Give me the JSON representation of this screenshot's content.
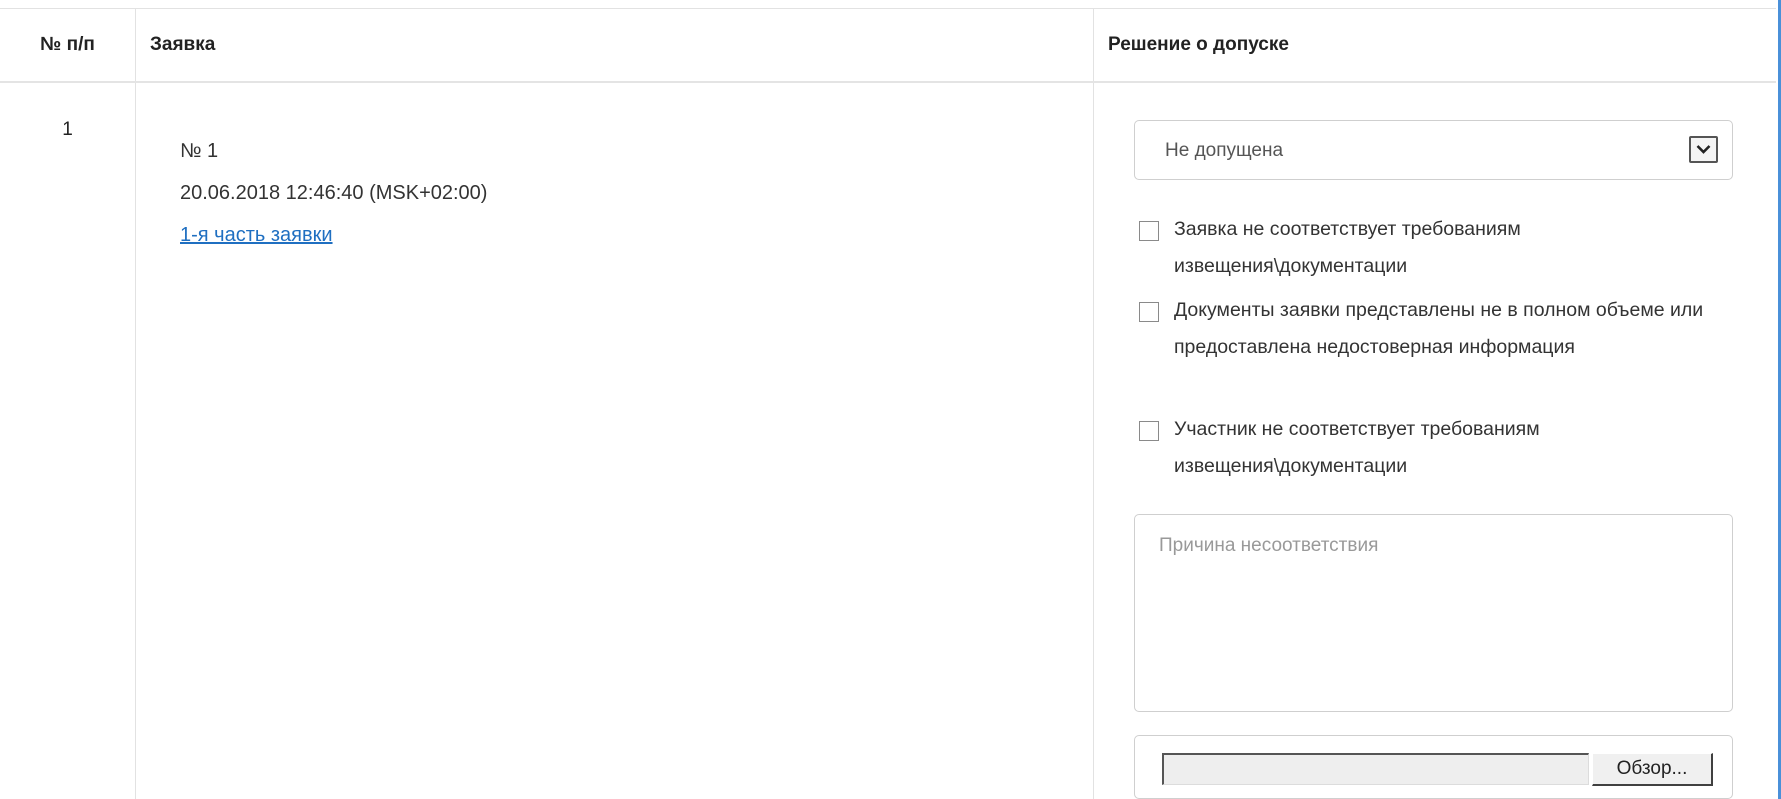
{
  "table": {
    "headers": {
      "num": "№ п/п",
      "request": "Заявка",
      "decision": "Решение о допуске"
    },
    "row": {
      "num": "1",
      "request_number": "№ 1",
      "request_datetime": "20.06.2018 12:46:40 (MSK+02:00)",
      "request_link": "1-я часть заявки"
    }
  },
  "decision": {
    "select_value": "Не допущена",
    "checkboxes": [
      {
        "label": "Заявка не соответствует требованиям извещения\\документации",
        "checked": false
      },
      {
        "label": "Документы заявки представлены не в полном объеме или предоставлена недостоверная информация",
        "checked": false
      },
      {
        "label": "Участник не соответствует требованиям извещения\\документации",
        "checked": false
      }
    ],
    "reason_placeholder": "Причина несоответствия",
    "reason_value": "",
    "file_path": "",
    "browse_label": "Обзор..."
  },
  "colors": {
    "link": "#1f6fc1",
    "border": "#cfcfcf",
    "frame_accent": "#4a90d9"
  },
  "icons": {
    "select_arrow": "chevron-down-icon"
  }
}
